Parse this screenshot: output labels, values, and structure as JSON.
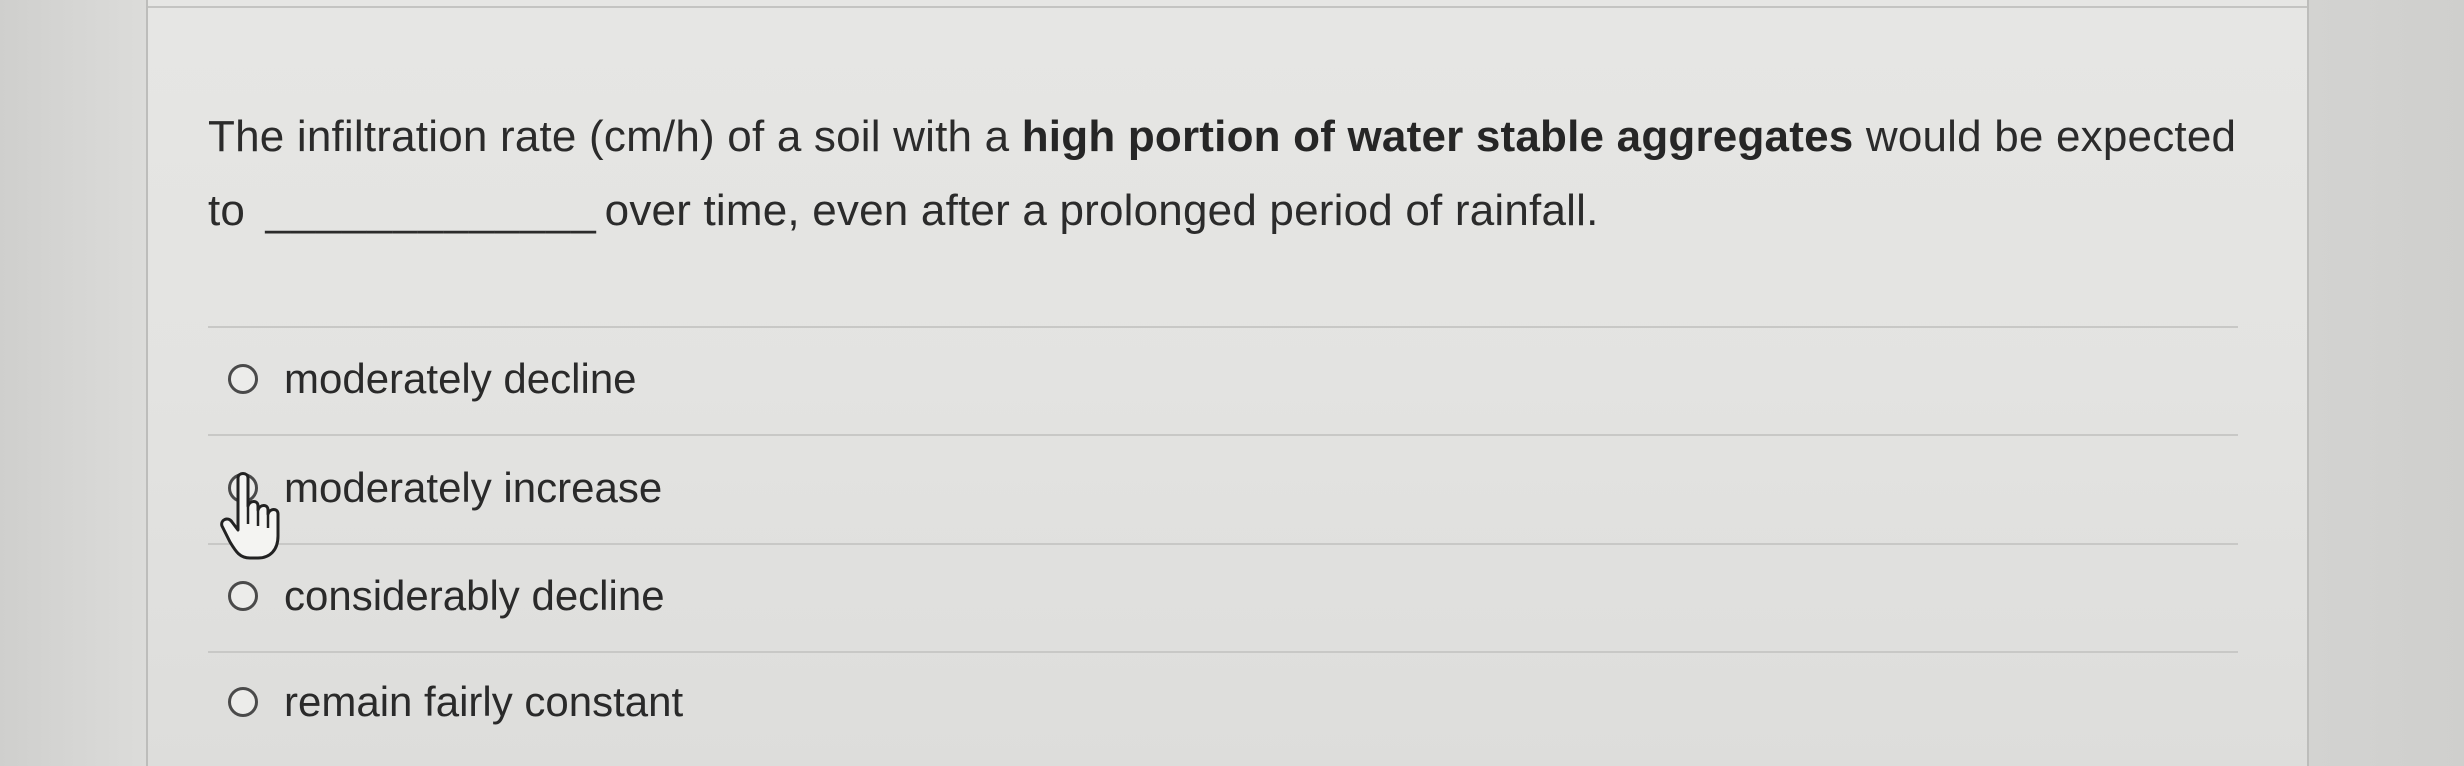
{
  "question": {
    "text_before_bold": "The infiltration rate (cm/h) of a soil with a ",
    "bold_text": "high portion of water stable aggregates",
    "text_after_bold": " would be expected to",
    "blank": "_____________",
    "text_end": "over time, even after a prolonged period of rainfall."
  },
  "options": [
    {
      "label": "moderately decline",
      "selected": false
    },
    {
      "label": "moderately increase",
      "selected": false
    },
    {
      "label": "considerably decline",
      "selected": false
    },
    {
      "label": "remain fairly constant",
      "selected": false
    }
  ],
  "cursor": {
    "icon": "hand-pointer-icon"
  }
}
